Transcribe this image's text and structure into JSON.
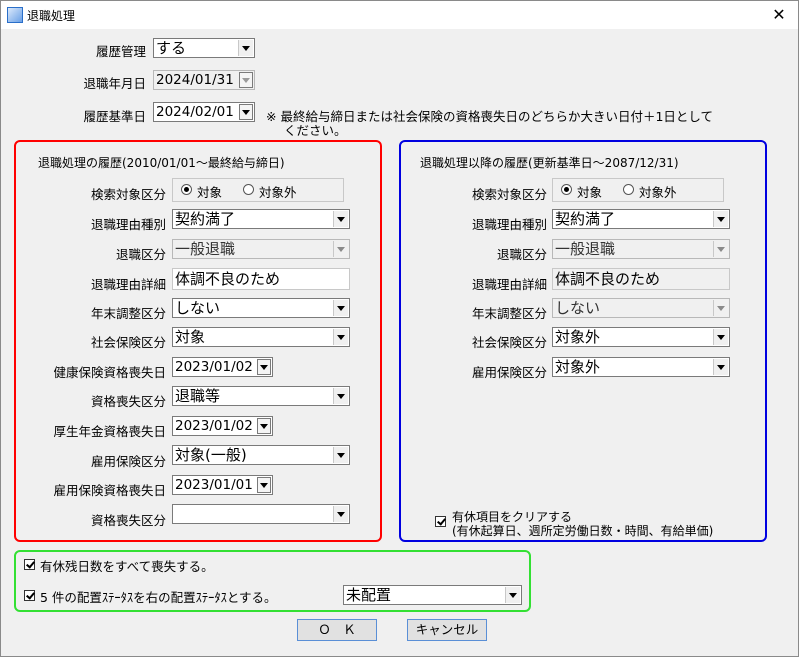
{
  "window": {
    "title": "退職処理",
    "close": "✕"
  },
  "top": {
    "rireki_kanri": {
      "label": "履歴管理",
      "value": "する"
    },
    "taishoku_date": {
      "label": "退職年月日",
      "value": "2024/01/31"
    },
    "rireki_kijun": {
      "label": "履歴基準日",
      "value": "2024/02/01"
    },
    "note_line1": "※ 最終給与締日または社会保険の資格喪失日のどちらか大きい日付＋1日として",
    "note_line2": "ください。"
  },
  "left": {
    "title": "退職処理の履歴(2010/01/01～最終給与締日)",
    "kensaku": {
      "label": "検索対象区分",
      "opt1": "対象",
      "opt2": "対象外"
    },
    "riyu_shubetsu": {
      "label": "退職理由種別",
      "value": "契約満了"
    },
    "taishoku_kubun": {
      "label": "退職区分",
      "value": "一般退職"
    },
    "riyu_shosai": {
      "label": "退職理由詳細",
      "value": "体調不良のため"
    },
    "nenmatsu": {
      "label": "年末調整区分",
      "value": "しない"
    },
    "shakai_hoken": {
      "label": "社会保険区分",
      "value": "対象"
    },
    "kenko_soshitsu": {
      "label": "健康保険資格喪失日",
      "value": "2023/01/02"
    },
    "soshitsu_kubun": {
      "label": "資格喪失区分",
      "value": "退職等"
    },
    "kosei_soshitsu": {
      "label": "厚生年金資格喪失日",
      "value": "2023/01/02"
    },
    "koyo_hoken": {
      "label": "雇用保険区分",
      "value": "対象(一般)"
    },
    "koyo_soshitsu": {
      "label": "雇用保険資格喪失日",
      "value": "2023/01/01"
    },
    "shikaku_kubun": {
      "label": "資格喪失区分",
      "value": ""
    }
  },
  "right": {
    "title": "退職処理以降の履歴(更新基準日～2087/12/31)",
    "kensaku": {
      "label": "検索対象区分",
      "opt1": "対象",
      "opt2": "対象外"
    },
    "riyu_shubetsu": {
      "label": "退職理由種別",
      "value": "契約満了"
    },
    "taishoku_kubun": {
      "label": "退職区分",
      "value": "一般退職"
    },
    "riyu_shosai": {
      "label": "退職理由詳細",
      "value": "体調不良のため"
    },
    "nenmatsu": {
      "label": "年末調整区分",
      "value": "しない"
    },
    "shakai_hoken": {
      "label": "社会保険区分",
      "value": "対象外"
    },
    "koyo_hoken": {
      "label": "雇用保険区分",
      "value": "対象外"
    },
    "yukyu_clear_line1": "有休項目をクリアする",
    "yukyu_clear_line2": "(有休起算日、週所定労働日数・時間、有給単価)"
  },
  "bottom": {
    "yukyu_soshitsu": "有休残日数をすべて喪失する。",
    "haichi_status": "5 件の配置ｽﾃｰﾀｽを右の配置ｽﾃｰﾀｽとする。",
    "haichi_value": "未配置"
  },
  "buttons": {
    "ok": "Ｏ　Ｋ",
    "cancel": "キャンセル"
  },
  "colors": {
    "left_frame": "#ff0000",
    "right_frame": "#0000e0",
    "bottom_frame": "#33e033"
  }
}
